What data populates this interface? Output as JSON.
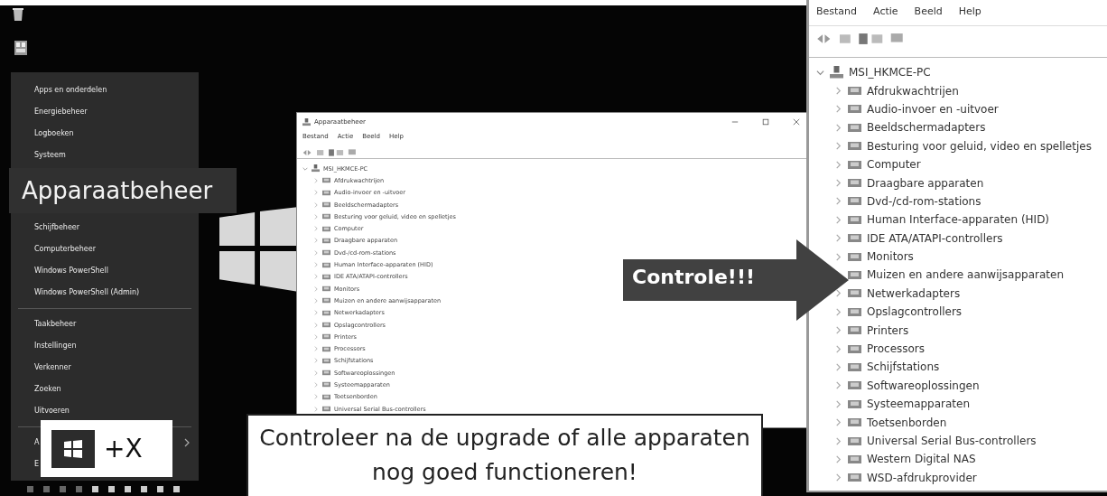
{
  "start_menu": {
    "groups": [
      [
        {
          "label": "Apps en onderdelen",
          "selected": false
        },
        {
          "label": "Energiebeheer",
          "selected": false
        },
        {
          "label": "Logboeken",
          "selected": false
        },
        {
          "label": "Systeem",
          "selected": false
        },
        {
          "label": "Apparaatbeheer",
          "selected": true
        },
        {
          "label": "Schijfbeheer",
          "selected": false
        },
        {
          "label": "Computerbeheer",
          "selected": false
        },
        {
          "label": "Windows PowerShell",
          "selected": false
        },
        {
          "label": "Windows PowerShell (Admin)",
          "selected": false
        }
      ],
      [
        {
          "label": "Taakbeheer",
          "selected": false
        },
        {
          "label": "Instellingen",
          "selected": false
        },
        {
          "label": "Verkenner",
          "selected": false
        },
        {
          "label": "Zoeken",
          "selected": false
        },
        {
          "label": "Uitvoeren",
          "selected": false
        }
      ],
      [
        {
          "label": "A",
          "selected": false,
          "submenu": true
        },
        {
          "label": "E",
          "selected": false,
          "submenu": false
        }
      ]
    ]
  },
  "shortcut": {
    "keys": "+X"
  },
  "device_manager_window": {
    "title": "Apparaatbeheer",
    "menu": [
      "Bestand",
      "Actie",
      "Beeld",
      "Help"
    ],
    "tree": {
      "label": "MSI_HKMCE-PC",
      "expanded": true,
      "children": [
        {
          "label": "Afdrukwachtrijen",
          "expanded": false
        },
        {
          "label": "Audio-invoer en -uitvoer",
          "expanded": false
        },
        {
          "label": "Beeldschermadapters",
          "expanded": false
        },
        {
          "label": "Besturing voor geluid, video en spelletjes",
          "expanded": false
        },
        {
          "label": "Computer",
          "expanded": false
        },
        {
          "label": "Draagbare apparaten",
          "expanded": false
        },
        {
          "label": "Dvd-/cd-rom-stations",
          "expanded": false
        },
        {
          "label": "Human Interface-apparaten (HID)",
          "expanded": false
        },
        {
          "label": "IDE ATA/ATAPI-controllers",
          "expanded": false
        },
        {
          "label": "Monitors",
          "expanded": false
        },
        {
          "label": "Muizen en andere aanwijsapparaten",
          "expanded": false
        },
        {
          "label": "Netwerkadapters",
          "expanded": false
        },
        {
          "label": "Opslagcontrollers",
          "expanded": false
        },
        {
          "label": "Printers",
          "expanded": false
        },
        {
          "label": "Processors",
          "expanded": false
        },
        {
          "label": "Schijfstations",
          "expanded": false
        },
        {
          "label": "Softwareoplossingen",
          "expanded": false
        },
        {
          "label": "Systeemapparaten",
          "expanded": false
        },
        {
          "label": "Toetsenborden",
          "expanded": false
        },
        {
          "label": "Universal Serial Bus-controllers",
          "expanded": false
        }
      ]
    }
  },
  "zoomed_window": {
    "menu": [
      "Bestand",
      "Actie",
      "Beeld",
      "Help"
    ],
    "tree": {
      "label": "MSI_HKMCE-PC",
      "expanded": true,
      "children": [
        {
          "label": "Afdrukwachtrijen",
          "expanded": false
        },
        {
          "label": "Audio-invoer en -uitvoer",
          "expanded": false
        },
        {
          "label": "Beeldschermadapters",
          "expanded": false
        },
        {
          "label": "Besturing voor geluid, video en spelletjes",
          "expanded": false
        },
        {
          "label": "Computer",
          "expanded": false
        },
        {
          "label": "Draagbare apparaten",
          "expanded": false
        },
        {
          "label": "Dvd-/cd-rom-stations",
          "expanded": false
        },
        {
          "label": "Human Interface-apparaten (HID)",
          "expanded": false
        },
        {
          "label": "IDE ATA/ATAPI-controllers",
          "expanded": false
        },
        {
          "label": "Monitors",
          "expanded": false
        },
        {
          "label": "Muizen en andere aanwijsapparaten",
          "expanded": false
        },
        {
          "label": "Netwerkadapters",
          "expanded": false
        },
        {
          "label": "Opslagcontrollers",
          "expanded": false
        },
        {
          "label": "Printers",
          "expanded": false
        },
        {
          "label": "Processors",
          "expanded": false
        },
        {
          "label": "Schijfstations",
          "expanded": false
        },
        {
          "label": "Softwareoplossingen",
          "expanded": false
        },
        {
          "label": "Systeemapparaten",
          "expanded": false
        },
        {
          "label": "Toetsenborden",
          "expanded": false
        },
        {
          "label": "Universal Serial Bus-controllers",
          "expanded": false
        },
        {
          "label": "Western Digital NAS",
          "expanded": false
        },
        {
          "label": "WSD-afdrukprovider",
          "expanded": false
        }
      ]
    }
  },
  "callouts": [
    {
      "kind": "arrow",
      "text": "Controle!!!"
    },
    {
      "kind": "note",
      "text": "Controleer na de upgrade of alle apparaten nog goed functioneren!"
    }
  ]
}
